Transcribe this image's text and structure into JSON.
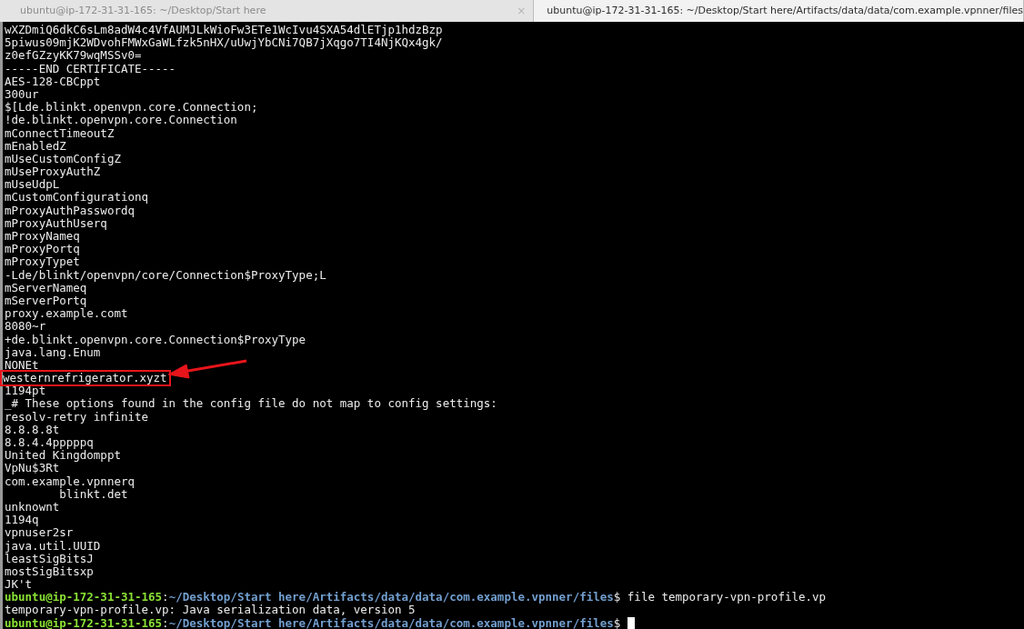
{
  "tabs": [
    {
      "label": "ubuntu@ip-172-31-31-165: ~/Desktop/Start here",
      "selected": false,
      "close": "×"
    },
    {
      "label": "ubuntu@ip-172-31-31-165: ~/Desktop/Start here/Artifacts/data/data/com.example.vpnner/files",
      "selected": true
    }
  ],
  "lines": [
    {
      "kind": "output",
      "text": "wXZDmiQ6dkC6sLm8adW4c4VfAUMJLkWioFw3ETe1WcIvu4SXA54dlETjp1hdzBzp"
    },
    {
      "kind": "output",
      "text": "5piwus09mjK2WDvohFMWxGaWLfzk5nHX/uUwjYbCNi7QB7jXqgo7TI4NjKQx4gk/"
    },
    {
      "kind": "output",
      "text": "z0efGZzyKK79wqMSSv0="
    },
    {
      "kind": "output",
      "text": "-----END CERTIFICATE-----"
    },
    {
      "kind": "output",
      "text": "AES-128-CBCppt"
    },
    {
      "kind": "output",
      "text": "300ur"
    },
    {
      "kind": "output",
      "text": "$[Lde.blinkt.openvpn.core.Connection;"
    },
    {
      "kind": "output",
      "text": "!de.blinkt.openvpn.core.Connection"
    },
    {
      "kind": "output",
      "text": "mConnectTimeoutZ"
    },
    {
      "kind": "output",
      "text": "mEnabledZ"
    },
    {
      "kind": "output",
      "text": "mUseCustomConfigZ"
    },
    {
      "kind": "output",
      "text": "mUseProxyAuthZ"
    },
    {
      "kind": "output",
      "text": "mUseUdpL"
    },
    {
      "kind": "output",
      "text": "mCustomConfigurationq"
    },
    {
      "kind": "output",
      "text": "mProxyAuthPasswordq"
    },
    {
      "kind": "output",
      "text": "mProxyAuthUserq"
    },
    {
      "kind": "output",
      "text": "mProxyNameq"
    },
    {
      "kind": "output",
      "text": "mProxyPortq"
    },
    {
      "kind": "output",
      "text": "mProxyTypet"
    },
    {
      "kind": "output",
      "text": "-Lde/blinkt/openvpn/core/Connection$ProxyType;L"
    },
    {
      "kind": "output",
      "text": "mServerNameq"
    },
    {
      "kind": "output",
      "text": "mServerPortq"
    },
    {
      "kind": "output",
      "text": "proxy.example.comt"
    },
    {
      "kind": "output",
      "text": "8080~r"
    },
    {
      "kind": "output",
      "text": "+de.blinkt.openvpn.core.Connection$ProxyType"
    },
    {
      "kind": "output",
      "text": "java.lang.Enum"
    },
    {
      "kind": "output",
      "text": "NONEt"
    },
    {
      "kind": "output",
      "text": "westernrefrigerator.xyzt",
      "highlighted": true
    },
    {
      "kind": "output",
      "text": "1194pt"
    },
    {
      "kind": "output",
      "text": "_# These options found in the config file do not map to config settings:"
    },
    {
      "kind": "output",
      "text": "resolv-retry infinite"
    },
    {
      "kind": "output",
      "text": "8.8.8.8t"
    },
    {
      "kind": "output",
      "text": "8.8.4.4pppppq"
    },
    {
      "kind": "output",
      "text": "United Kingdomppt"
    },
    {
      "kind": "output",
      "text": "VpNu$3Rt"
    },
    {
      "kind": "output",
      "text": "com.example.vpnnerq"
    },
    {
      "kind": "output",
      "text": "        blinkt.det"
    },
    {
      "kind": "output",
      "text": "unknownt"
    },
    {
      "kind": "output",
      "text": "1194q"
    },
    {
      "kind": "output",
      "text": "vpnuser2sr"
    },
    {
      "kind": "output",
      "text": "java.util.UUID"
    },
    {
      "kind": "output",
      "text": "leastSigBitsJ"
    },
    {
      "kind": "output",
      "text": "mostSigBitsxp"
    },
    {
      "kind": "output",
      "text": "JK't"
    },
    {
      "kind": "prompt",
      "user": "ubuntu@ip-172-31-31-165",
      "colon": ":",
      "path": "~/Desktop/Start here/Artifacts/data/data/com.example.vpnner/files",
      "symbol": "$",
      "command": "file temporary-vpn-profile.vp"
    },
    {
      "kind": "output",
      "text": "temporary-vpn-profile.vp: Java serialization data, version 5"
    },
    {
      "kind": "prompt",
      "user": "ubuntu@ip-172-31-31-165",
      "colon": ":",
      "path": "~/Desktop/Start here/Artifacts/data/data/com.example.vpnner/files",
      "symbol": "$",
      "cursor": true
    }
  ]
}
